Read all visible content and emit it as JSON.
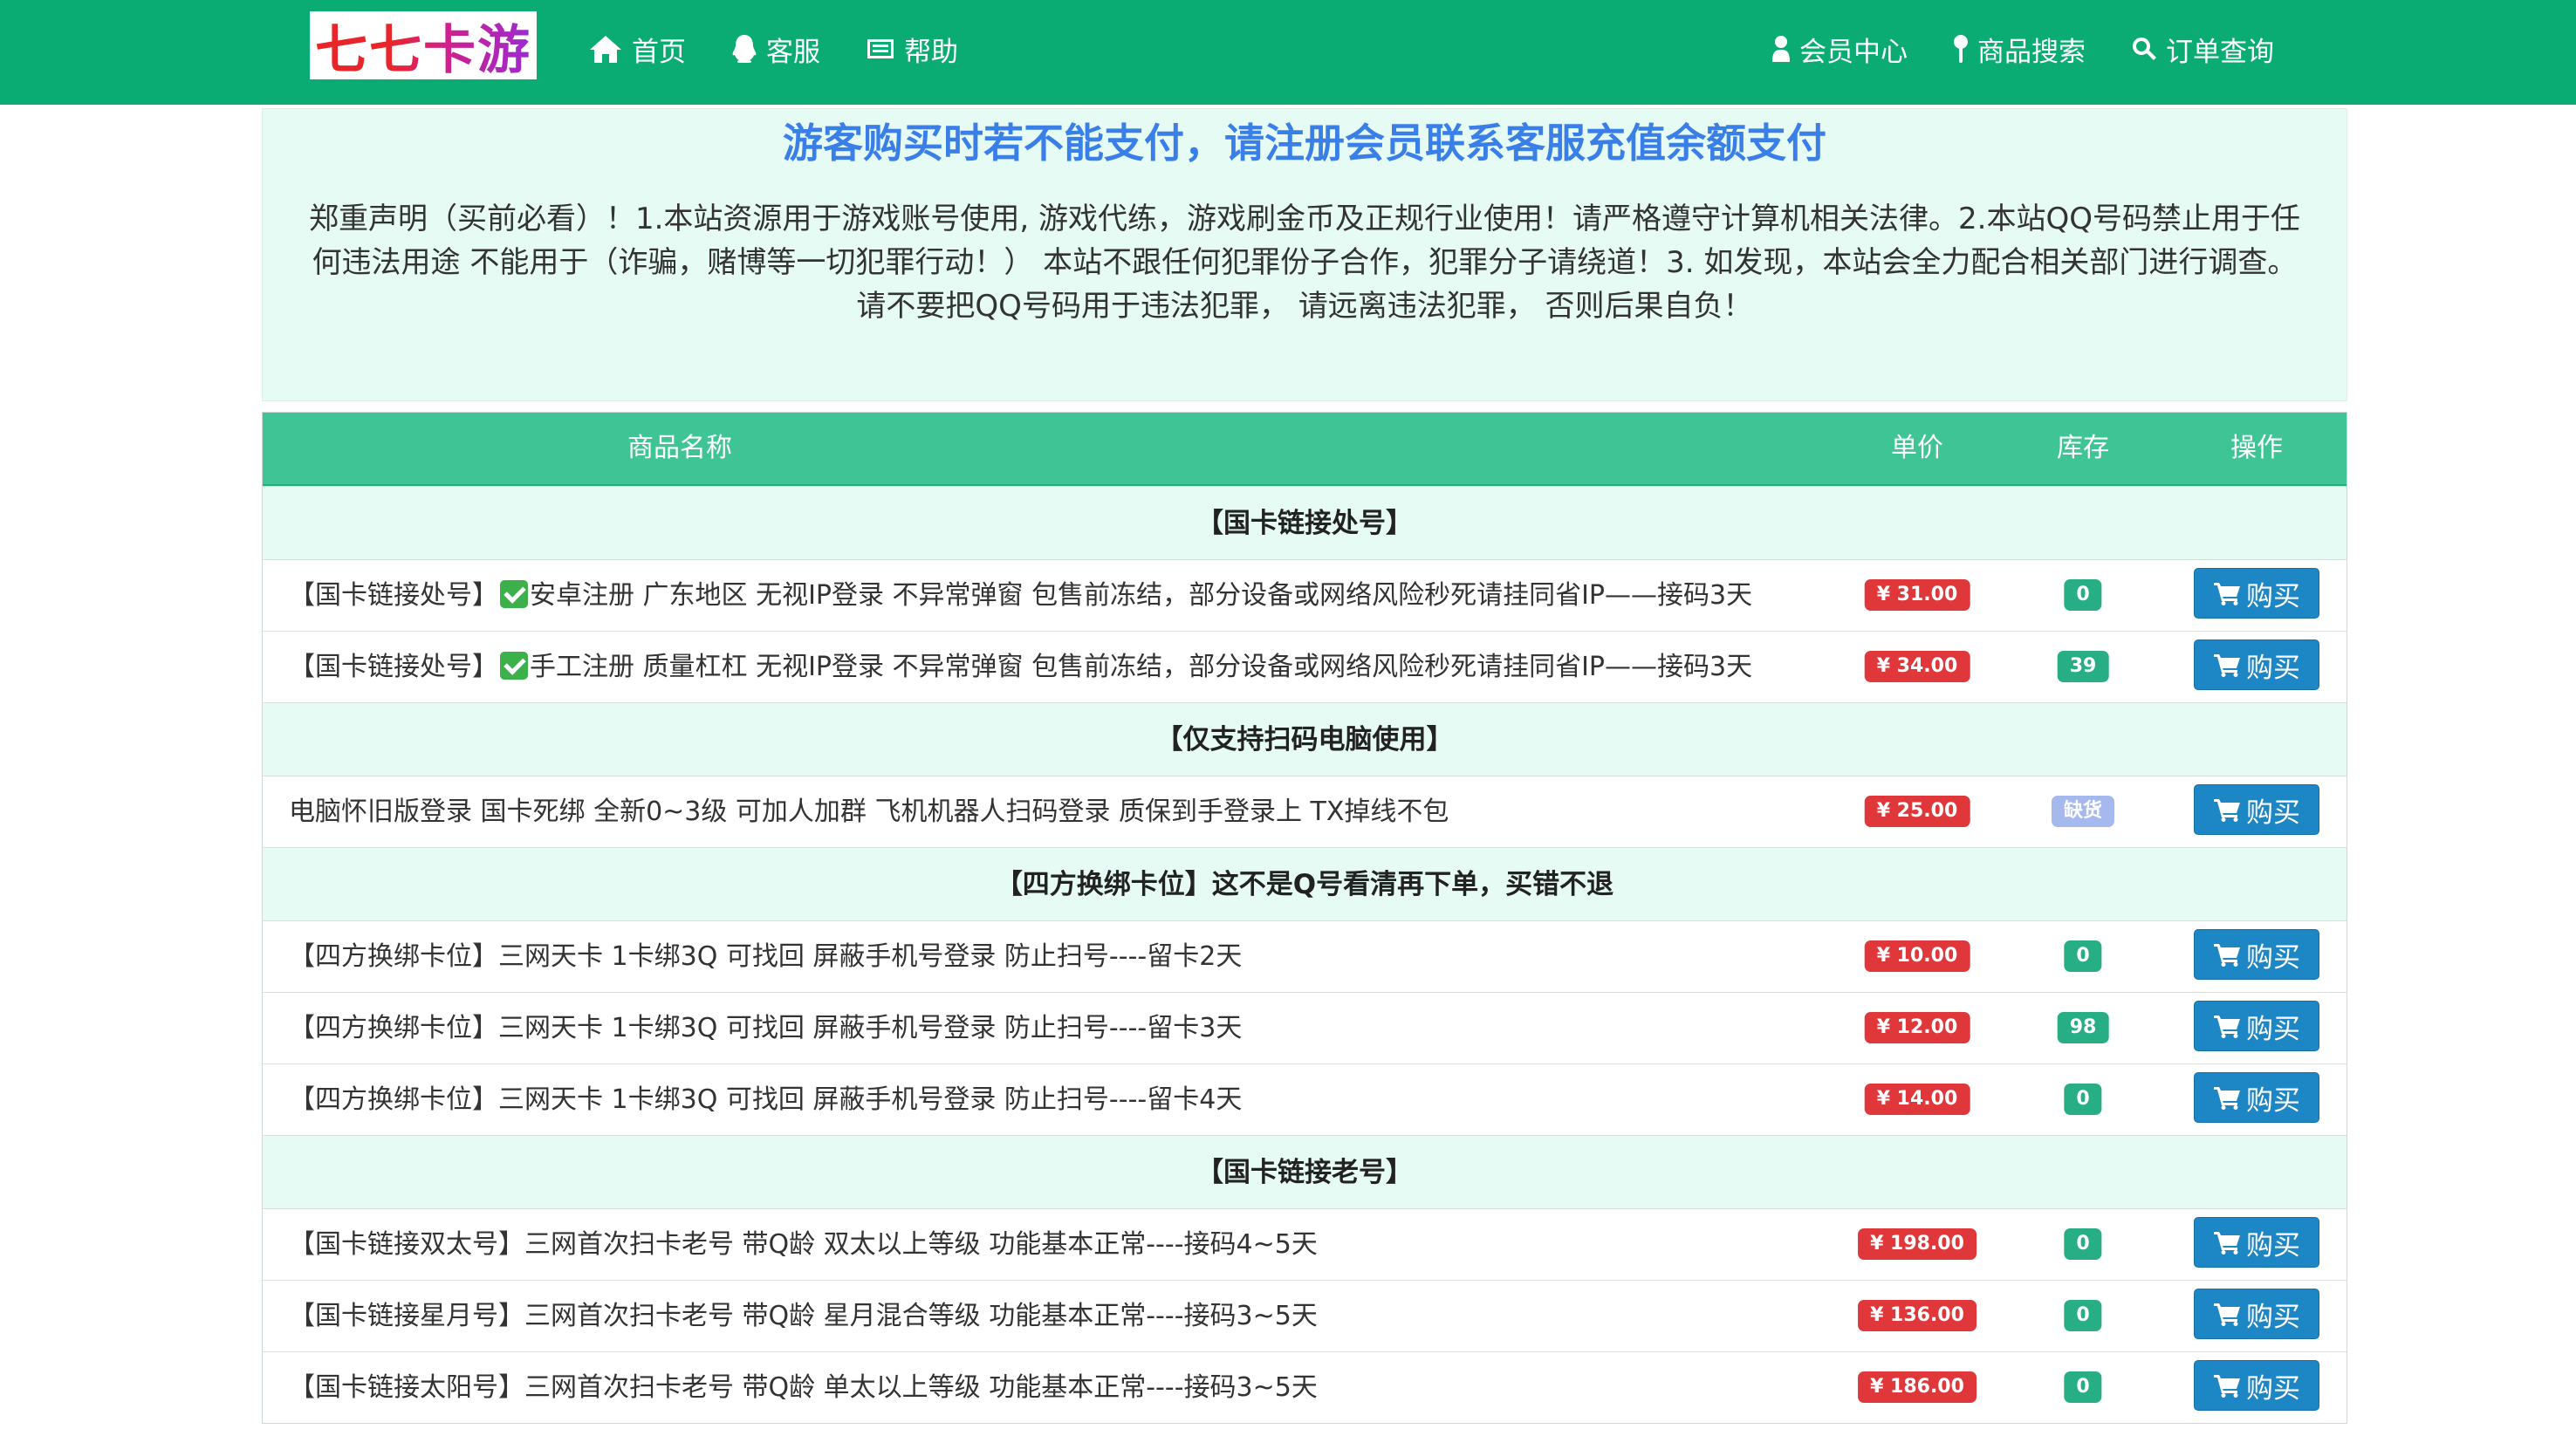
{
  "brand": {
    "logo_text": "七七卡游"
  },
  "nav": {
    "left": [
      {
        "label": "首页",
        "icon": "home-icon"
      },
      {
        "label": "客服",
        "icon": "qq-icon"
      },
      {
        "label": "帮助",
        "icon": "list-icon"
      }
    ],
    "right": [
      {
        "label": "会员中心",
        "icon": "user-icon"
      },
      {
        "label": "商品搜索",
        "icon": "map-marker-icon"
      },
      {
        "label": "订单查询",
        "icon": "search-icon"
      }
    ]
  },
  "notice": {
    "title": "游客购买时若不能支付，请注册会员联系客服充值余额支付",
    "body": "郑重声明（买前必看）！1.本站资源用于游戏账号使用, 游戏代练，游戏刷金币及正规行业使用！请严格遵守计算机相关法律。2.本站QQ号码禁止用于任何违法用途 不能用于（诈骗，赌博等一切犯罪行动！） 本站不跟任何犯罪份子合作，犯罪分子请绕道！3. 如发现，本站会全力配合相关部门进行调查。 请不要把QQ号码用于违法犯罪， 请远离违法犯罪， 否则后果自负！"
  },
  "table": {
    "headers": {
      "name": "商品名称",
      "price": "单价",
      "stock": "库存",
      "action": "操作"
    },
    "buy_label": "购买",
    "groups": [
      {
        "category": "【国卡链接处号】",
        "items": [
          {
            "prefix": "【国卡链接处号】",
            "check": true,
            "name": "安卓注册 广东地区 无视IP登录 不异常弹窗 包售前冻结，部分设备或网络风险秒死请挂同省IP——接码3天",
            "price": "¥ 31.00",
            "stock": "0",
            "out": false
          },
          {
            "prefix": "【国卡链接处号】",
            "check": true,
            "name": "手工注册 质量杠杠 无视IP登录 不异常弹窗 包售前冻结，部分设备或网络风险秒死请挂同省IP——接码3天",
            "price": "¥ 34.00",
            "stock": "39",
            "out": false
          }
        ]
      },
      {
        "category": "【仅支持扫码电脑使用】",
        "items": [
          {
            "prefix": "",
            "check": false,
            "name": "电脑怀旧版登录 国卡死绑 全新0~3级 可加人加群 飞机机器人扫码登录 质保到手登录上 TX掉线不包",
            "price": "¥ 25.00",
            "stock": "缺货",
            "out": true
          }
        ]
      },
      {
        "category": "【四方换绑卡位】这不是Q号看清再下单，买错不退",
        "items": [
          {
            "prefix": "",
            "check": false,
            "name": "【四方换绑卡位】三网天卡 1卡绑3Q 可找回 屏蔽手机号登录 防止扫号----留卡2天",
            "price": "¥ 10.00",
            "stock": "0",
            "out": false
          },
          {
            "prefix": "",
            "check": false,
            "name": "【四方换绑卡位】三网天卡 1卡绑3Q 可找回 屏蔽手机号登录 防止扫号----留卡3天",
            "price": "¥ 12.00",
            "stock": "98",
            "out": false
          },
          {
            "prefix": "",
            "check": false,
            "name": "【四方换绑卡位】三网天卡 1卡绑3Q 可找回 屏蔽手机号登录 防止扫号----留卡4天",
            "price": "¥ 14.00",
            "stock": "0",
            "out": false
          }
        ]
      },
      {
        "category": "【国卡链接老号】",
        "items": [
          {
            "prefix": "",
            "check": false,
            "name": "【国卡链接双太号】三网首次扫卡老号 带Q龄 双太以上等级 功能基本正常----接码4~5天",
            "price": "¥ 198.00",
            "stock": "0",
            "out": false
          },
          {
            "prefix": "",
            "check": false,
            "name": "【国卡链接星月号】三网首次扫卡老号 带Q龄 星月混合等级 功能基本正常----接码3~5天",
            "price": "¥ 136.00",
            "stock": "0",
            "out": false
          },
          {
            "prefix": "",
            "check": false,
            "name": "【国卡链接太阳号】三网首次扫卡老号 带Q龄 单太以上等级 功能基本正常----接码3~5天",
            "price": "¥ 186.00",
            "stock": "0",
            "out": false
          }
        ]
      }
    ]
  }
}
